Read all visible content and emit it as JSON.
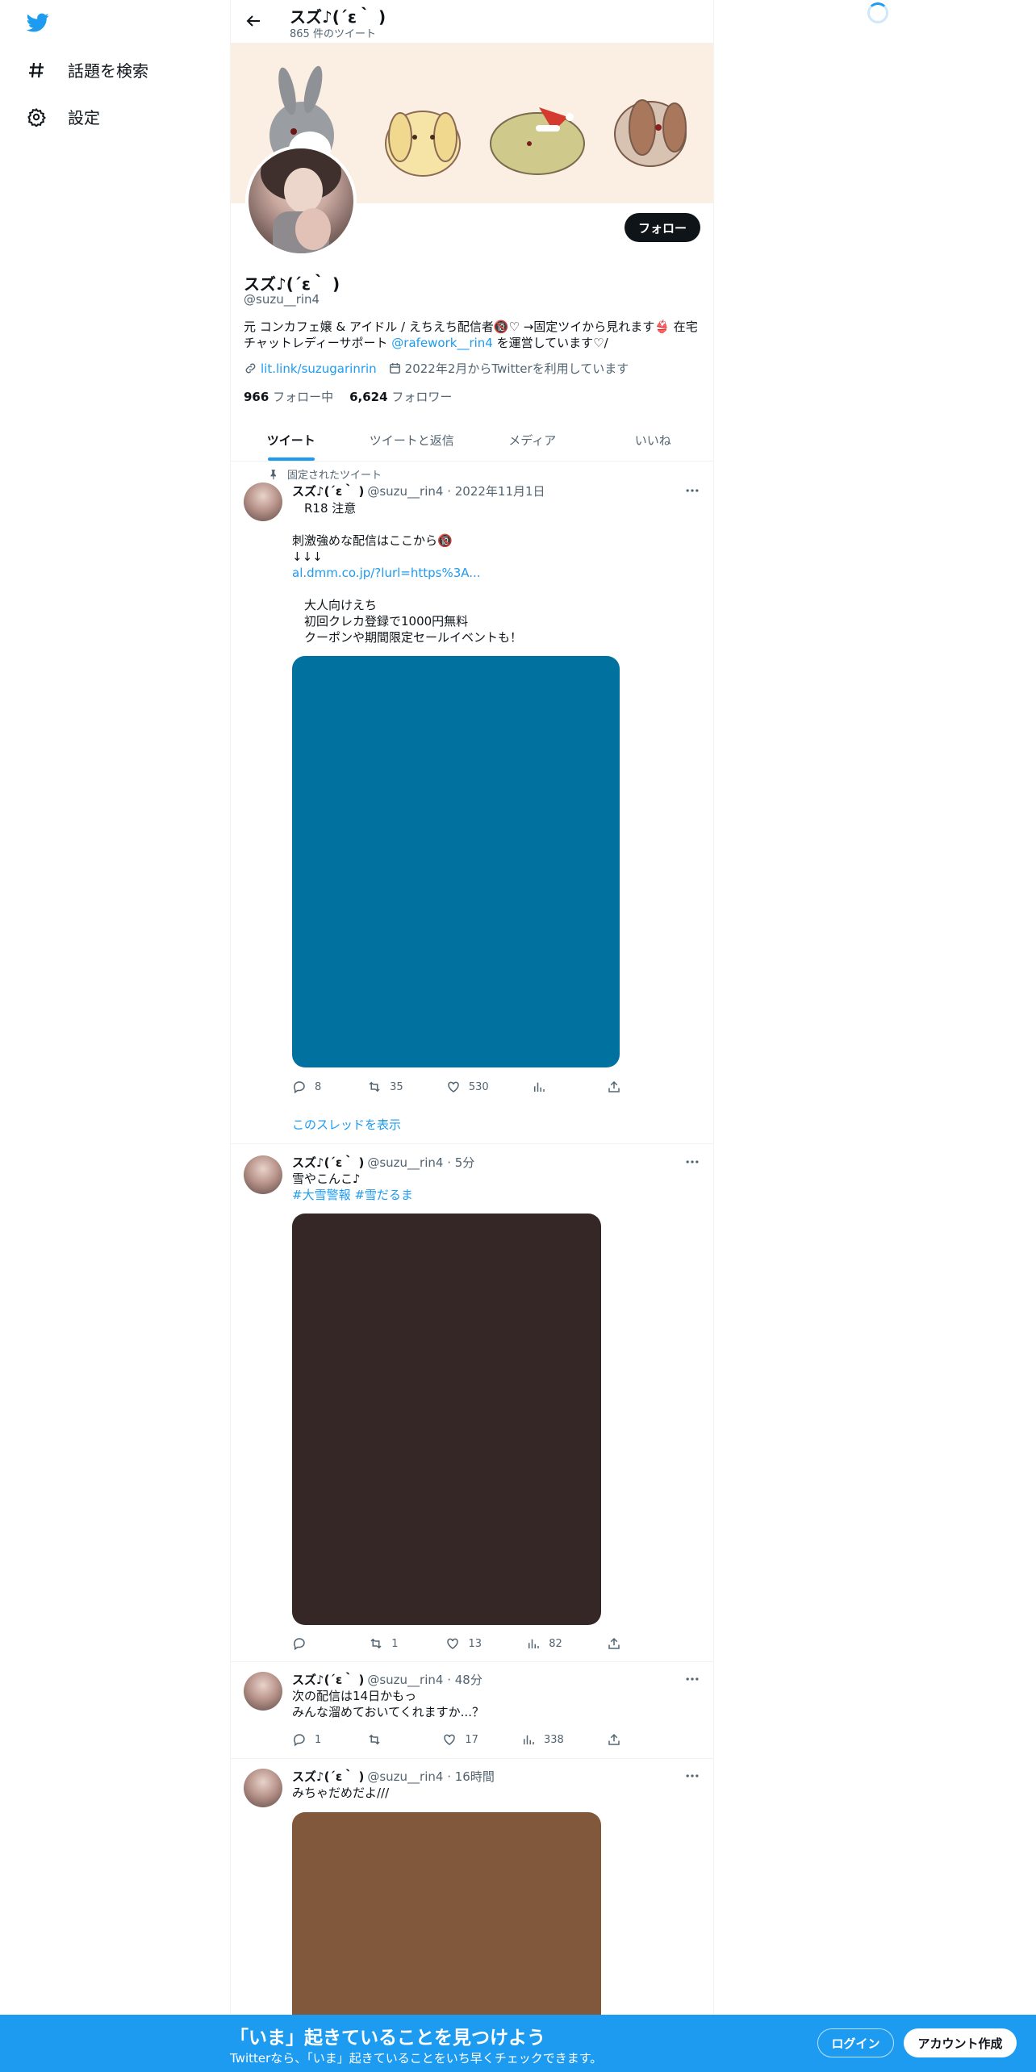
{
  "nav": {
    "logo_icon": "twitter-bird-icon",
    "items": [
      {
        "label": "話題を検索",
        "icon": "hashtag-icon"
      },
      {
        "label": "設定",
        "icon": "gear-icon"
      }
    ]
  },
  "header": {
    "name": "スズ♪(´ε｀ )",
    "tweet_count": "865 件のツイート"
  },
  "profile": {
    "follow_label": "フォロー",
    "display_name": "スズ♪(´ε｀ )",
    "handle": "@suzu__rin4",
    "bio_part1": "元 コンカフェ嬢 & アイドル / えちえち配信者🔞♡ →固定ツイから見れます👙 在宅チャットレディーサポート ",
    "bio_mention": "@rafework__rin4",
    "bio_part2": " を運営しています♡/",
    "link": "lit.link/suzugarinrin",
    "joined": "2022年2月からTwitterを利用しています",
    "following_count": "966",
    "following_label": "フォロー中",
    "followers_count": "6,624",
    "followers_label": "フォロワー"
  },
  "tabs": [
    {
      "label": "ツイート",
      "active": true
    },
    {
      "label": "ツイートと返信",
      "active": false
    },
    {
      "label": "メディア",
      "active": false
    },
    {
      "label": "いいね",
      "active": false
    }
  ],
  "tweets": [
    {
      "pinned_label": "固定されたツイート",
      "name": "スズ♪(´ε｀ )",
      "meta": "@suzu__rin4 · 2022年11月1日",
      "lines": [
        "　R18 注意",
        "",
        "刺激強めな配信はここから🔞",
        "↓↓↓",
        "al.dmm.co.jp/?lurl=https%3A...",
        "",
        "　大人向けえち",
        "　初回クレカ登録で1000円無料",
        "　クーポンや期間限定セールイベントも！"
      ],
      "media_color": "#01729f",
      "reply": "8",
      "retweet": "35",
      "like": "530",
      "views": "",
      "show_thread": "このスレッドを表示"
    },
    {
      "name": "スズ♪(´ε｀ )",
      "meta": "@suzu__rin4 · 5分",
      "lines": [
        "雪やこんこ♪",
        "#大雪警報 #雪だるま"
      ],
      "media_color": "#342725",
      "reply": "",
      "retweet": "1",
      "like": "13",
      "views": "82"
    },
    {
      "name": "スズ♪(´ε｀ )",
      "meta": "@suzu__rin4 · 48分",
      "lines": [
        "次の配信は14日かもっ",
        "みんな溜めておいてくれますか...？"
      ],
      "reply": "1",
      "retweet": "",
      "like": "17",
      "views": "338"
    },
    {
      "name": "スズ♪(´ε｀ )",
      "meta": "@suzu__rin4 · 16時間",
      "lines": [
        "みちゃだめだよ///"
      ],
      "media_color": "#82583c"
    }
  ],
  "bottom_bar": {
    "title": "「いま」起きていることを見つけよう",
    "subtitle": "Twitterなら、「いま」起きていることをいち早くチェックできます。",
    "login": "ログイン",
    "signup": "アカウント作成"
  }
}
